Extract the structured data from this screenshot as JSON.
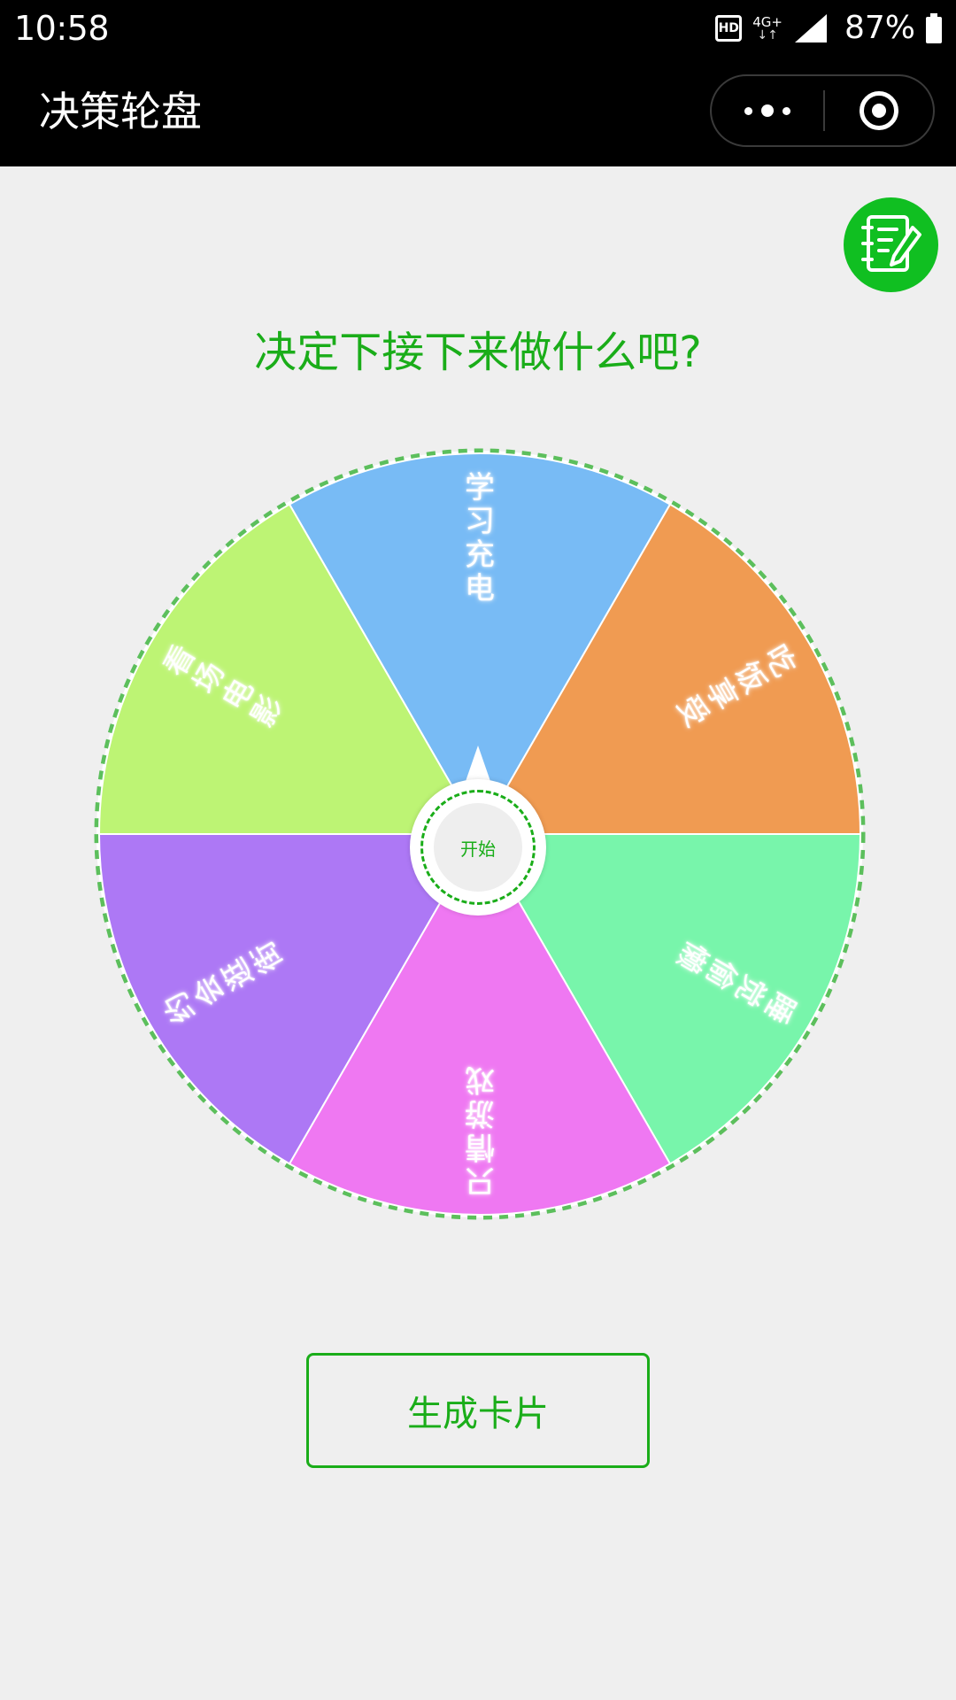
{
  "status_bar": {
    "time": "10:58",
    "hd": "HD",
    "network": "4G+",
    "network_arrows": "↓↑",
    "battery": "87%"
  },
  "title_bar": {
    "title": "决策轮盘",
    "more_icon": "more-dots-icon",
    "close_icon": "target-icon"
  },
  "record_button": {
    "icon": "notebook-pen-icon",
    "color": "#10bf21"
  },
  "heading": "决定下接下来做什么吧?",
  "wheel": {
    "prizes": [
      {
        "label": "学习充电",
        "color": "#78bbf5"
      },
      {
        "label": "吃饭享受",
        "color": "#f09b52"
      },
      {
        "label": "睡觉偷懒",
        "color": "#78f5ab"
      },
      {
        "label": "只情游戏",
        "color": "#ef78f2"
      },
      {
        "label": "约会逛街",
        "color": "#ad78f5"
      },
      {
        "label": "看场电影",
        "color": "#bdf474"
      }
    ],
    "border_color": "#5cbf5c",
    "start_label": "开始"
  },
  "generate_button": {
    "label": "生成卡片"
  }
}
